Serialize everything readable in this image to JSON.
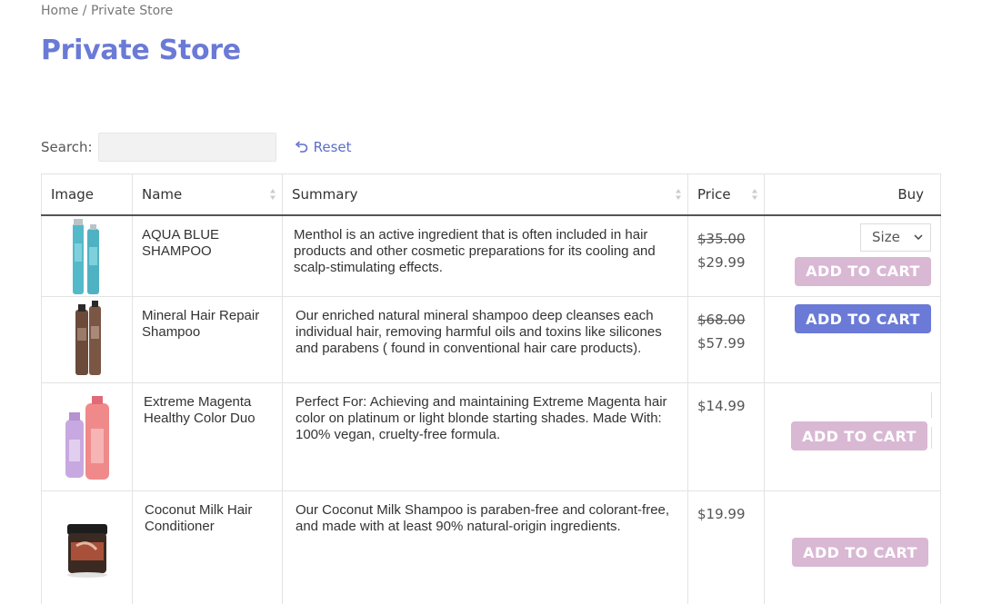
{
  "breadcrumb": {
    "home": "Home",
    "separator": " / ",
    "current": "Private Store"
  },
  "page_title": "Private Store",
  "search": {
    "label": "Search:",
    "value": "",
    "placeholder": ""
  },
  "reset_label": "Reset",
  "table": {
    "headers": {
      "image": "Image",
      "name": "Name",
      "summary": "Summary",
      "price": "Price",
      "buy": "Buy"
    },
    "rows": [
      {
        "name": "AQUA BLUE SHAMPOO",
        "summary": "Menthol is an active ingredient that is often included in hair products and other cosmetic preparations for its cooling and scalp-stimulating effects.",
        "old_price": "$35.00",
        "price": "$29.99",
        "size_label": "Size",
        "button": "ADD TO CART"
      },
      {
        "name": "Mineral Hair Repair Shampoo",
        "summary": "Our enriched natural mineral shampoo deep cleanses each individual hair, removing harmful oils and toxins like silicones and parabens ( found in conventional hair care products).",
        "old_price": "$68.00",
        "price": "$57.99",
        "button": "ADD TO CART"
      },
      {
        "name": "Extreme Magenta Healthy Color Duo",
        "summary": "Perfect For: Achieving and maintaining Extreme Magenta hair color on platinum or light blonde starting shades. Made With: 100% vegan, cruelty-free formula.",
        "price": "$14.99",
        "button": "ADD TO CART"
      },
      {
        "name": "Coconut Milk Hair Conditioner",
        "summary": "Our Coconut Milk Shampoo is paraben-free and colorant-free, and made with at least 90% natural-origin ingredients.",
        "price": "$19.99",
        "button": "ADD TO CART"
      }
    ]
  },
  "colors": {
    "accent": "#6a7ad6",
    "button_disabled": "#d9b8d4",
    "link": "#5b6fc9"
  }
}
